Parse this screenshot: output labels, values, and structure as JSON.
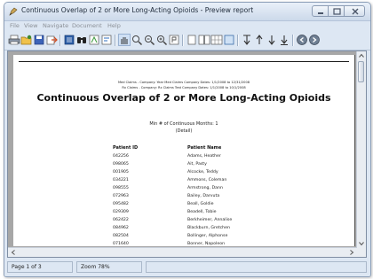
{
  "window": {
    "title": "Continuous Overlap of 2 or More Long-Acting Opioids - Preview report",
    "icon": "app-icon"
  },
  "menu": [
    "File",
    "View",
    "Navigate",
    "Document",
    "Help"
  ],
  "toolbar": {
    "icons": [
      "print-icon",
      "open-icon",
      "save-icon",
      "export-icon",
      "page-setup-icon",
      "find-icon",
      "watermark-icon",
      "parameters-icon",
      "hand-tool-icon",
      "magnifier-icon",
      "zoom-out-icon",
      "zoom-in-icon",
      "zoom-percent-icon",
      "single-page-icon",
      "two-pages-icon",
      "multiple-pages-icon",
      "background-icon",
      "first-page-icon",
      "previous-page-icon",
      "next-page-icon",
      "last-page-icon",
      "back-icon",
      "forward-icon"
    ]
  },
  "report": {
    "criteria_line1": "Med Claims - Company: Year Med Claims Company Dates: 1/1/2008 to 12/31/2008",
    "criteria_line2": "Rx Claims - Company: Rx Claims Test Company Dates: 1/1/2008 to 10/1/2008",
    "title": "Continuous Overlap of 2 or More Long-Acting Opioids",
    "min_months": "Min # of Continuous Months: 1",
    "detail": "(Detail)",
    "columns": {
      "patient_id": "Patient ID",
      "patient_name": "Patient Name"
    },
    "rows": [
      {
        "id": "042256",
        "name": "Adams, Heather"
      },
      {
        "id": "098065",
        "name": "Ait, Pasty"
      },
      {
        "id": "001905",
        "name": "Alcocke, Teddy"
      },
      {
        "id": "034221",
        "name": "Ammons, Coleman"
      },
      {
        "id": "098555",
        "name": "Armstrong, Dann"
      },
      {
        "id": "072963",
        "name": "Bailey, Darvuta"
      },
      {
        "id": "095482",
        "name": "Beall, Goldie"
      },
      {
        "id": "029309",
        "name": "Beadell, Tobie"
      },
      {
        "id": "062422",
        "name": "Berkheimer, Annalise"
      },
      {
        "id": "084962",
        "name": "Blackburn, Gretchen"
      },
      {
        "id": "082504",
        "name": "Bollinger, Alphonse"
      },
      {
        "id": "071640",
        "name": "Bonner, Napoleon"
      }
    ]
  },
  "status": {
    "page": "Page 1 of 3",
    "zoom": "Zoom 78%"
  },
  "colors": {
    "window_frame": "#dde7f3",
    "preview_background": "#a7a7a7",
    "page_background": "#ffffff"
  }
}
